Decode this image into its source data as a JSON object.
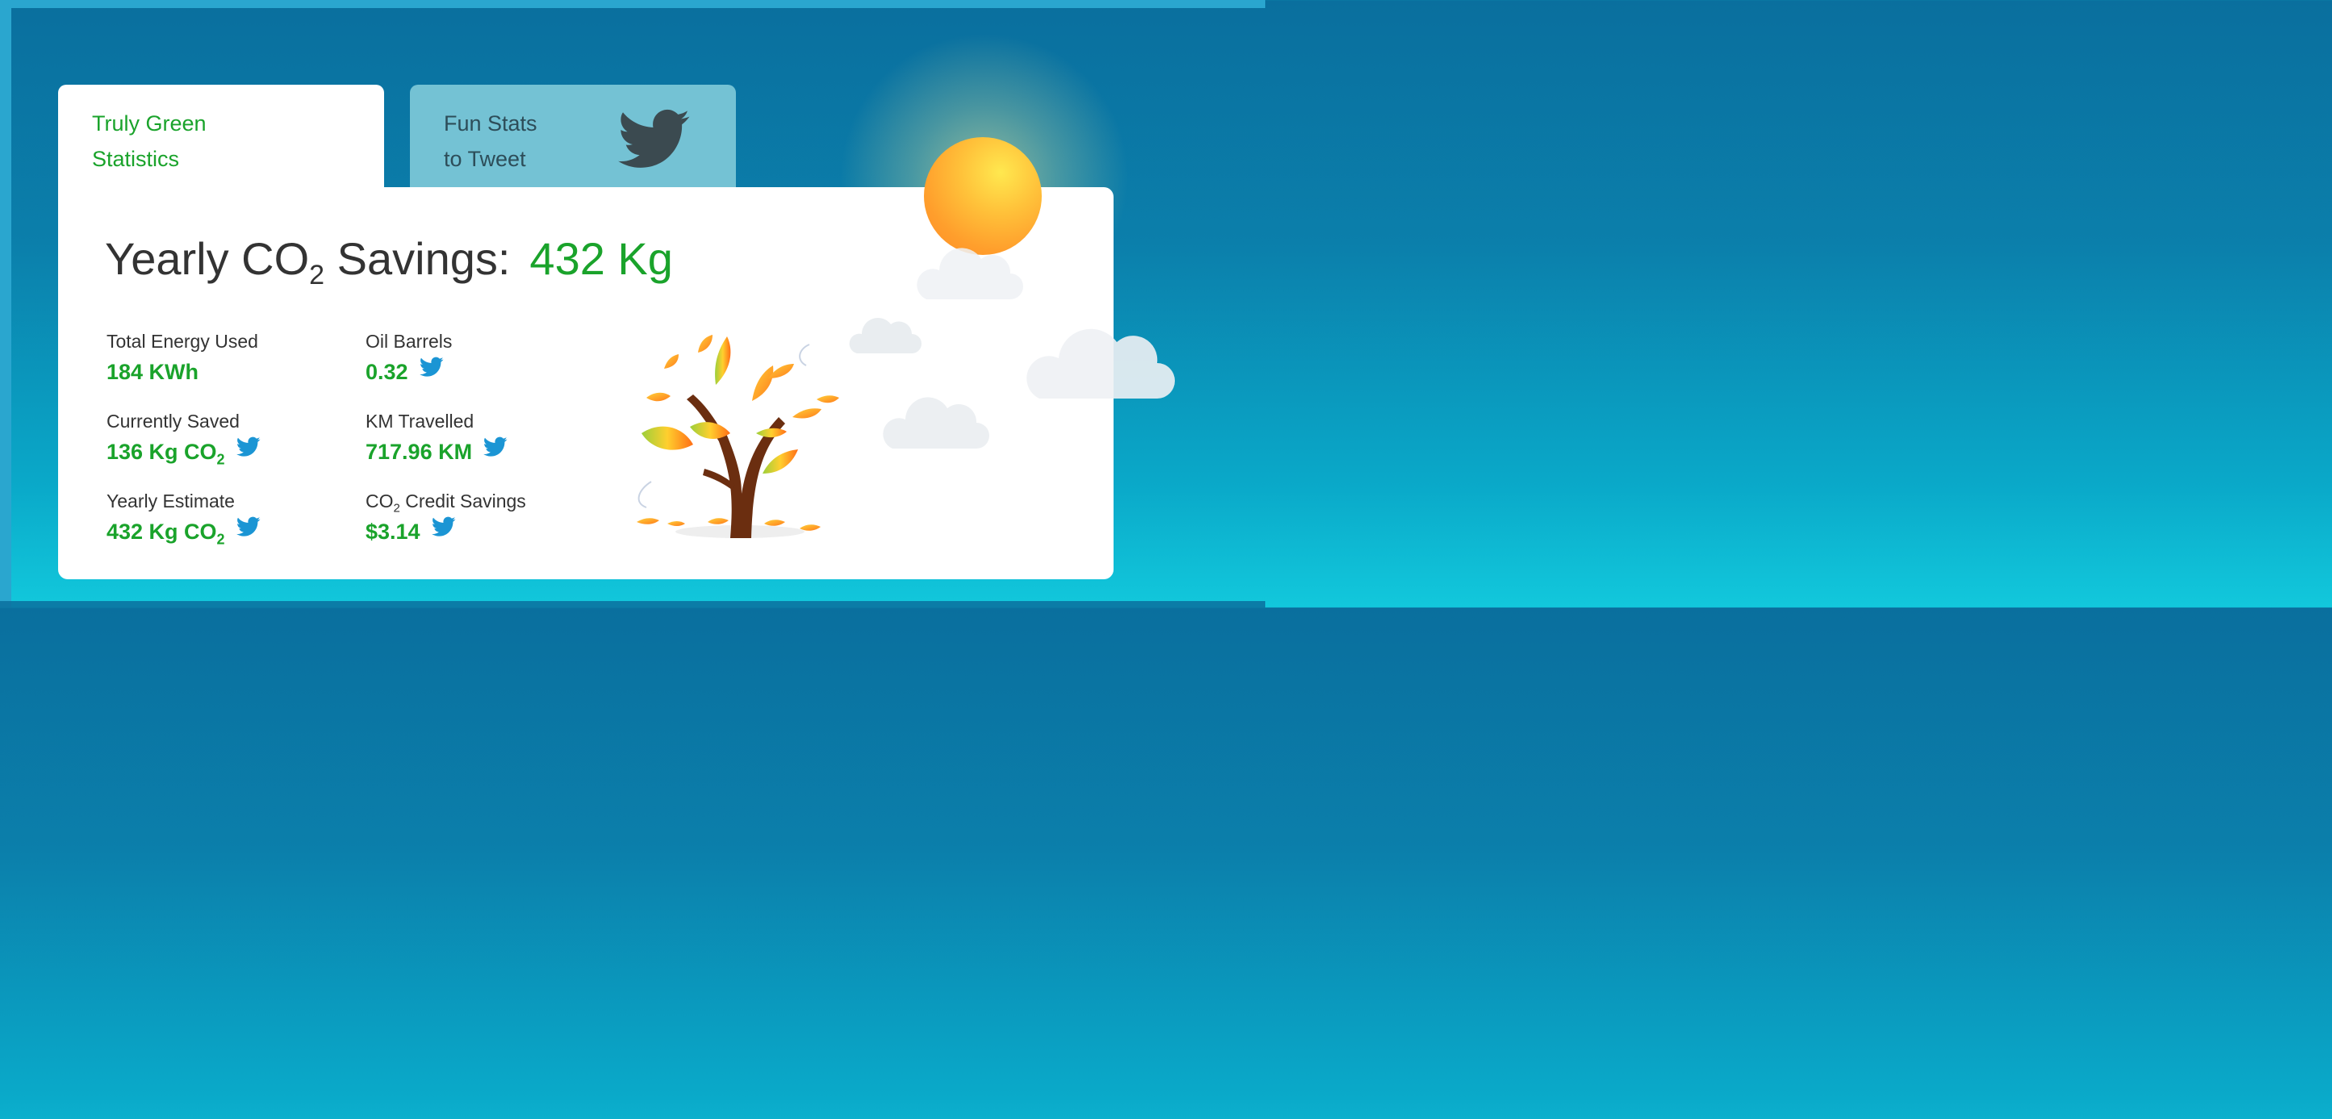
{
  "tabs": [
    {
      "label_line1": "Truly Green",
      "label_line2": "Statistics",
      "active": true
    },
    {
      "label_line1": "Fun Stats",
      "label_line2": "to Tweet",
      "icon": "twitter-bird-icon",
      "active": false
    }
  ],
  "headline": {
    "prefix": "Yearly CO",
    "sub": "2",
    "suffix": " Savings:",
    "value": "432 Kg"
  },
  "stats": [
    {
      "label": "Total Energy Used",
      "value": "184 KWh",
      "value_sub": "",
      "tweetable": false
    },
    {
      "label": "Oil Barrels",
      "value": "0.32",
      "value_sub": "",
      "tweetable": true
    },
    {
      "label": "Currently Saved",
      "value": "136 Kg CO",
      "value_sub": "2",
      "tweetable": true
    },
    {
      "label": "KM Travelled",
      "value": "717.96 KM",
      "value_sub": "",
      "tweetable": true
    },
    {
      "label": "Yearly Estimate",
      "value": "432 Kg CO",
      "value_sub": "2",
      "tweetable": true
    },
    {
      "label_prefix": "CO",
      "label_sub": "2",
      "label": " Credit Savings",
      "value": "$3.14",
      "value_sub": "",
      "tweetable": true
    }
  ],
  "colors": {
    "accent_green": "#1aa32b",
    "twitter_blue": "#1b95d4",
    "background_top": "#0a6f9e",
    "background_bottom": "#12c8dc",
    "tab_inactive": "#74c2d4"
  }
}
